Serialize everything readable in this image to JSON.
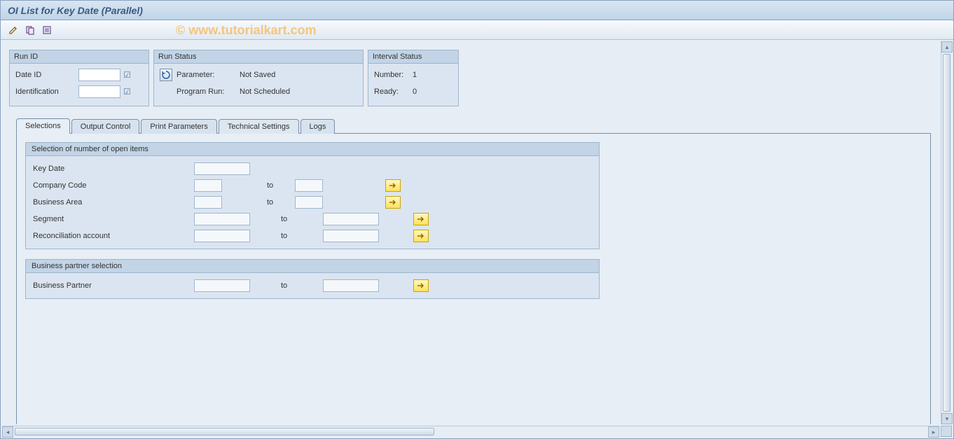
{
  "title": "OI List for Key Date (Parallel)",
  "watermark": "© www.tutorialkart.com",
  "toolbar": {
    "pencil_title": "Change",
    "copy_title": "Copy",
    "list_title": "Overview"
  },
  "runid": {
    "header": "Run ID",
    "date_id_label": "Date ID",
    "date_id_value": "",
    "identification_label": "Identification",
    "identification_value": ""
  },
  "runstatus": {
    "header": "Run Status",
    "parameter_label": "Parameter:",
    "parameter_value": "Not Saved",
    "programrun_label": "Program Run:",
    "programrun_value": "Not Scheduled"
  },
  "intervalstatus": {
    "header": "Interval Status",
    "number_label": "Number:",
    "number_value": "1",
    "ready_label": "Ready:",
    "ready_value": "0"
  },
  "tabs": {
    "selections": "Selections",
    "output_control": "Output Control",
    "print_parameters": "Print Parameters",
    "technical_settings": "Technical Settings",
    "logs": "Logs"
  },
  "group1": {
    "header": "Selection of number of open items",
    "key_date_label": "Key Date",
    "company_code_label": "Company Code",
    "business_area_label": "Business Area",
    "segment_label": "Segment",
    "recon_account_label": "Reconciliation account",
    "to_label": "to"
  },
  "group2": {
    "header": "Business partner selection",
    "bp_label": "Business Partner",
    "to_label": "to"
  }
}
